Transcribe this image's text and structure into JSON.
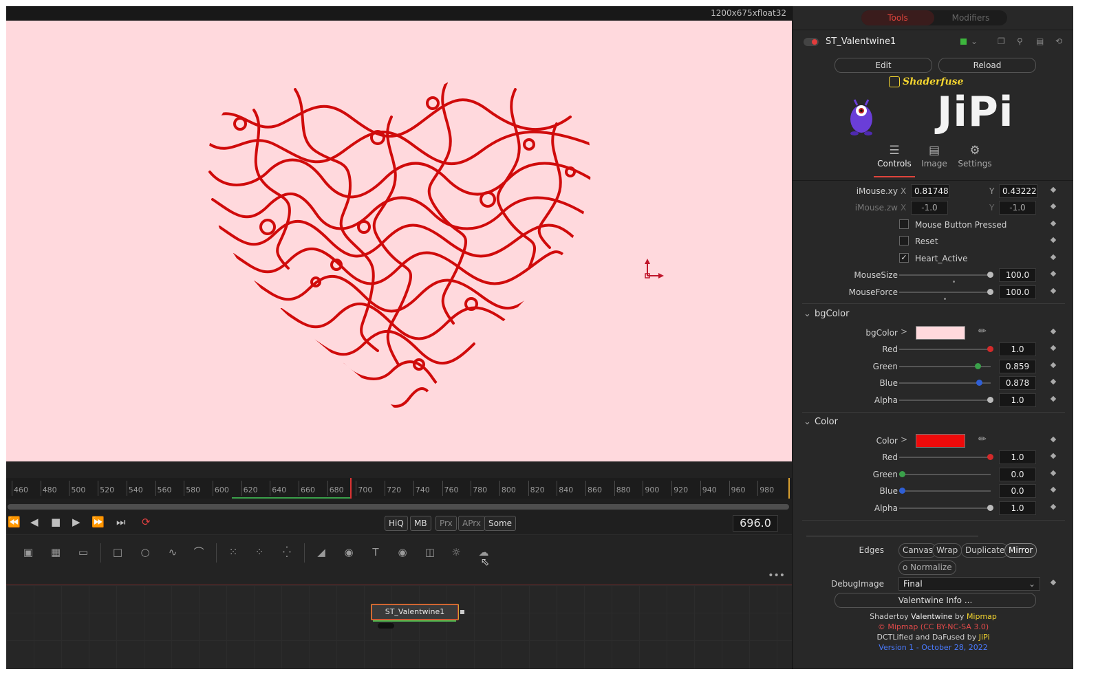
{
  "viewer": {
    "resolution_label": "1200x675xfloat32"
  },
  "timeline": {
    "ticks": [
      "460",
      "480",
      "500",
      "520",
      "540",
      "560",
      "580",
      "600",
      "620",
      "640",
      "660",
      "680",
      "700",
      "720",
      "740",
      "760",
      "780",
      "800",
      "820",
      "840",
      "860",
      "880",
      "900",
      "920",
      "940",
      "960",
      "980"
    ],
    "current_frame": "696.0"
  },
  "transport": {
    "quality_buttons": [
      "HiQ",
      "MB",
      "Prx",
      "APrx",
      "Some"
    ]
  },
  "node": {
    "name": "ST_Valentwine1"
  },
  "inspector": {
    "tabs": [
      "Tools",
      "Modifiers"
    ],
    "tool_name": "ST_Valentwine1",
    "edit_label": "Edit",
    "reload_label": "Reload",
    "shaderfuse_label": "Shaderfuse",
    "brand": "JiPi",
    "sub_tabs": [
      "Controls",
      "Image",
      "Settings"
    ],
    "imouse_xy": {
      "label": "iMouse.xy",
      "x_label": "X",
      "x": "0.817486",
      "y_label": "Y",
      "y": "0.432221"
    },
    "imouse_zw": {
      "label": "iMouse.zw",
      "x_label": "X",
      "x": "-1.0",
      "y_label": "Y",
      "y": "-1.0"
    },
    "checkboxes": [
      {
        "label": "Mouse Button Pressed",
        "checked": false
      },
      {
        "label": "Reset",
        "checked": false
      },
      {
        "label": "Heart_Active",
        "checked": true
      }
    ],
    "mouse_size": {
      "label": "MouseSize",
      "value": "100.0"
    },
    "mouse_force": {
      "label": "MouseForce",
      "value": "100.0"
    },
    "bgcolor_group": {
      "title": "bgColor",
      "label": "bgColor",
      "swatch": "#ffd9dd",
      "channels": [
        {
          "label": "Red",
          "value": "1.0",
          "level": 1.0,
          "knob": "#d42a2a"
        },
        {
          "label": "Green",
          "value": "0.859",
          "level": 0.859,
          "knob": "#3aa14a"
        },
        {
          "label": "Blue",
          "value": "0.878",
          "level": 0.878,
          "knob": "#2f5fd6"
        },
        {
          "label": "Alpha",
          "value": "1.0",
          "level": 1.0,
          "knob": "#bbbbbb"
        }
      ]
    },
    "color_group": {
      "title": "Color",
      "label": "Color",
      "swatch": "#ee0a0a",
      "channels": [
        {
          "label": "Red",
          "value": "1.0",
          "level": 1.0,
          "knob": "#d42a2a"
        },
        {
          "label": "Green",
          "value": "0.0",
          "level": 0.0,
          "knob": "#3aa14a"
        },
        {
          "label": "Blue",
          "value": "0.0",
          "level": 0.0,
          "knob": "#2f5fd6"
        },
        {
          "label": "Alpha",
          "value": "1.0",
          "level": 1.0,
          "knob": "#bbbbbb"
        }
      ]
    },
    "edges": {
      "label": "Edges",
      "options": [
        "Canvas",
        "Wrap",
        "Duplicate",
        "Mirror"
      ],
      "selected": "Mirror"
    },
    "normalize_label": "o Normalize",
    "debug_image": {
      "label": "DebugImage",
      "value": "Final"
    },
    "info_button": "Valentwine Info ...",
    "credits": {
      "line1_a": "Shadertoy ",
      "line1_b": "Valentwine",
      "line1_c": " by ",
      "line1_d": "Mipmap",
      "line2": "© Mipmap (CC BY-NC-SA 3.0)",
      "line3_a": "DCTLified and DaFused by ",
      "line3_b": "JiPi",
      "line4": "Version 1 - October 28, 2022"
    }
  }
}
